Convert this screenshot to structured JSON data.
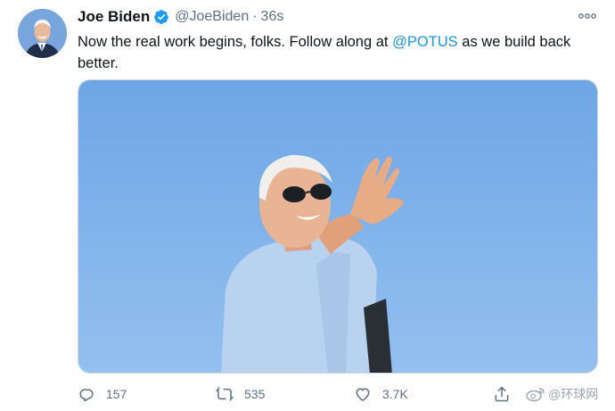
{
  "author": {
    "name": "Joe Biden",
    "handle": "@JoeBiden",
    "separator": "·",
    "time": "36s"
  },
  "tweet": {
    "text_before": "Now the real work begins, folks. Follow along at ",
    "mention": "@POTUS",
    "text_after": " as we build back better."
  },
  "actions": {
    "replies": "157",
    "retweets": "535",
    "likes": "3.7K"
  },
  "watermark": "@环球网",
  "colors": {
    "accent": "#1b95e0",
    "secondary_text": "#5b7083",
    "verified": "#1d9bf0",
    "photo_sky": "#7fb1ea"
  },
  "icons": [
    "verified-badge-icon",
    "more-options-icon",
    "reply-icon",
    "retweet-icon",
    "like-icon",
    "share-icon",
    "weibo-icon"
  ]
}
